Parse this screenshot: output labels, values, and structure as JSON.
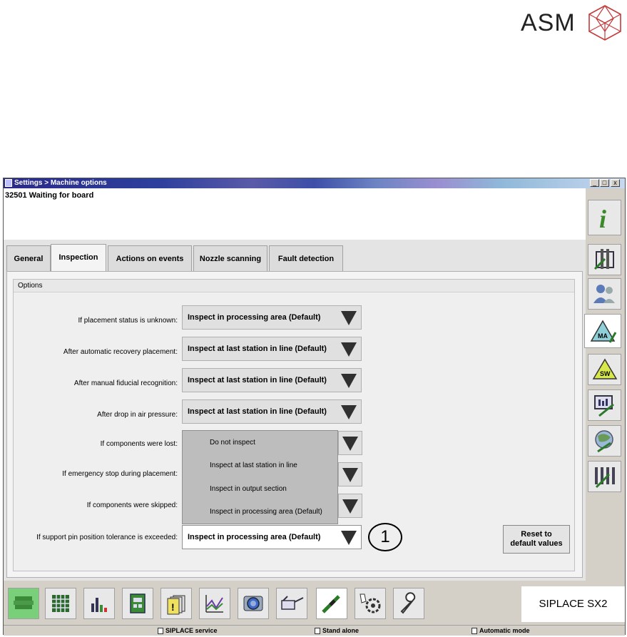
{
  "logo": {
    "text": "ASM"
  },
  "window": {
    "title": "Settings > Machine options",
    "status_message": "32501 Waiting for board",
    "controls": {
      "minimize": "_",
      "maximize": "□",
      "close": "x"
    }
  },
  "tabs": [
    {
      "label": "General",
      "active": false
    },
    {
      "label": "Inspection",
      "active": true
    },
    {
      "label": "Actions on events",
      "active": false
    },
    {
      "label": "Nozzle scanning",
      "active": false
    },
    {
      "label": "Fault detection",
      "active": false
    }
  ],
  "options": {
    "group_title": "Options",
    "rows": [
      {
        "label": "If placement status is unknown:",
        "value": "Inspect in processing area (Default)"
      },
      {
        "label": "After automatic recovery placement:",
        "value": "Inspect at last station in line (Default)"
      },
      {
        "label": "After manual fiducial recognition:",
        "value": "Inspect at last station in line (Default)"
      },
      {
        "label": "After drop in air pressure:",
        "value": "Inspect at last station in line (Default)"
      },
      {
        "label": "If components were lost:",
        "value": ""
      },
      {
        "label": "If emergency stop during placement:",
        "value": ""
      },
      {
        "label": "If components were skipped:",
        "value": ""
      },
      {
        "label": "If support pin position tolerance is exceeded:",
        "value": "Inspect in processing area (Default)"
      }
    ],
    "dropdown_options": [
      "Do not inspect",
      "Inspect at last station in line",
      "Inspect in output section",
      "Inspect in processing area (Default)"
    ],
    "reset_button": {
      "line1": "Reset to",
      "line2": "default values"
    },
    "callout": "1"
  },
  "sidebar_icons": [
    "info-icon",
    "machine-icon",
    "users-icon",
    "machine-settings-icon",
    "software-icon",
    "monitor-icon",
    "globe-icon",
    "tools-icon"
  ],
  "toolbar_icons": [
    "production-icon",
    "grid-icon",
    "chart-bars-icon",
    "board-icon",
    "warning-icon",
    "trend-chart-icon",
    "camera-icon",
    "oil-can-icon",
    "service-tool-icon",
    "gear-hand-icon",
    "wrench-icon"
  ],
  "brand": "SIPLACE SX2",
  "statusbar": {
    "user": "SIPLACE service",
    "line_mode": "Stand alone",
    "mode": "Automatic mode"
  },
  "colors": {
    "accent": "#2a2a8a",
    "panel": "#f4f4f4",
    "dropdown": "#bdbdbd"
  }
}
